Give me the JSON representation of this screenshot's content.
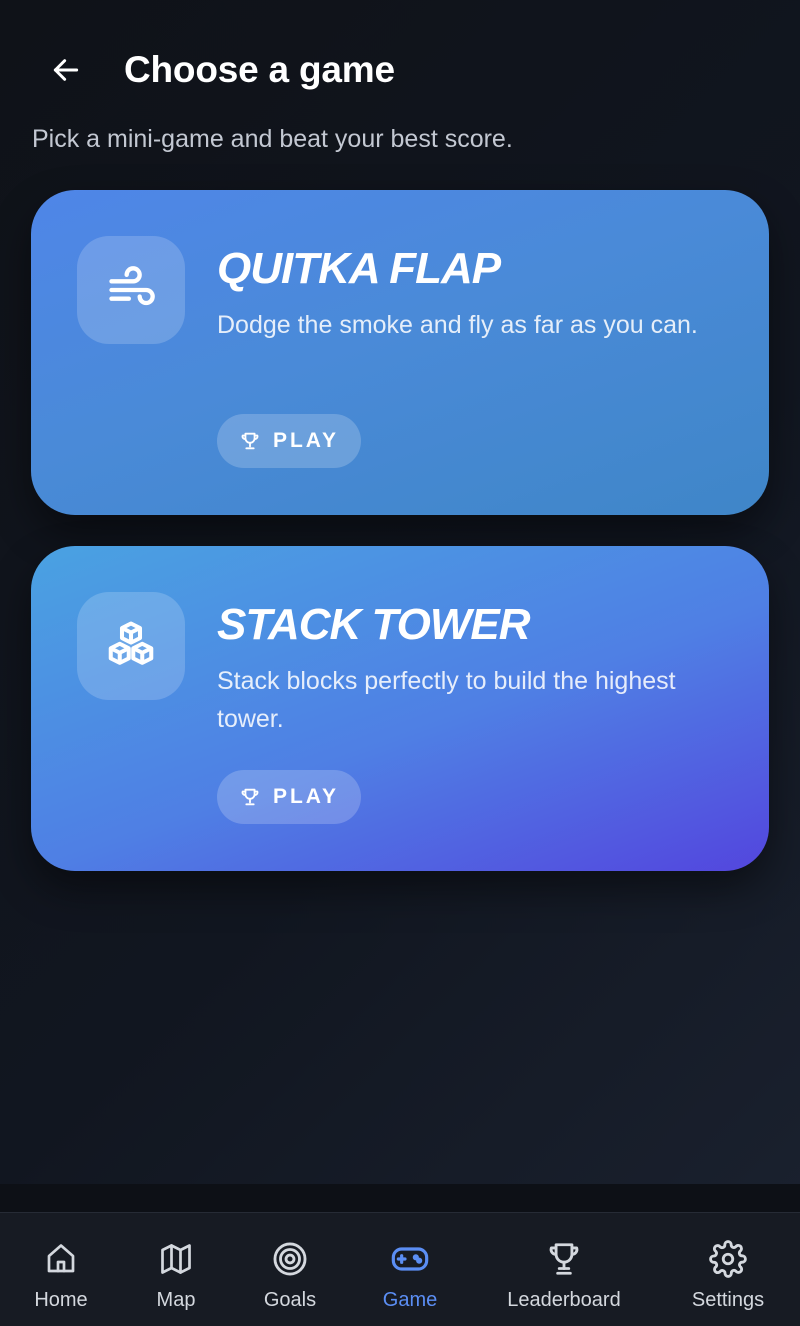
{
  "header": {
    "title": "Choose a game",
    "subtitle": "Pick a mini-game and beat your best score."
  },
  "games": [
    {
      "title": "QUITKA FLAP",
      "description": "Dodge the smoke and fly as far as you can.",
      "play_label": "PLAY",
      "icon": "wind-icon"
    },
    {
      "title": "STACK TOWER",
      "description": "Stack blocks perfectly to build the highest tower.",
      "play_label": "PLAY",
      "icon": "cubes-icon"
    }
  ],
  "nav": {
    "items": [
      {
        "label": "Home",
        "icon": "home-icon"
      },
      {
        "label": "Map",
        "icon": "map-icon"
      },
      {
        "label": "Goals",
        "icon": "target-icon"
      },
      {
        "label": "Game",
        "icon": "gamepad-icon",
        "active": true
      },
      {
        "label": "Leaderboard",
        "icon": "trophy-icon"
      },
      {
        "label": "Settings",
        "icon": "gear-icon"
      }
    ]
  },
  "colors": {
    "background": "#111620",
    "accent": "#5b8ef4",
    "card_1": "#4a8ad8",
    "card_2": "#5346de",
    "nav_background": "#171b23"
  }
}
